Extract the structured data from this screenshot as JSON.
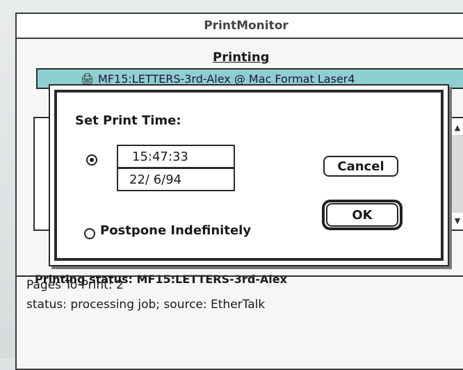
{
  "window": {
    "title": "PrintMonitor",
    "printing_heading": "Printing",
    "current_job": "MF15:LETTERS-3rd-Alex @ Mac Format Laser4",
    "status_line": "Printing status: MF15:LETTERS-3rd-Alex",
    "details": [
      "Pages To Print: 2",
      "status: processing job; source: EtherTalk"
    ]
  },
  "dialog": {
    "heading": "Set Print Time:",
    "time_value": "15:47:33",
    "date_value": "22/ 6/94",
    "postpone_label": "Postpone Indefinitely",
    "selected_option": "set_time",
    "cancel_label": "Cancel",
    "ok_label": "OK"
  },
  "icons": {
    "printer": "printer-icon",
    "scroll_up": "scroll-up-arrow-icon",
    "scroll_down": "scroll-down-arrow-icon"
  },
  "colors": {
    "current_job_highlight": "#8dd0cf"
  }
}
